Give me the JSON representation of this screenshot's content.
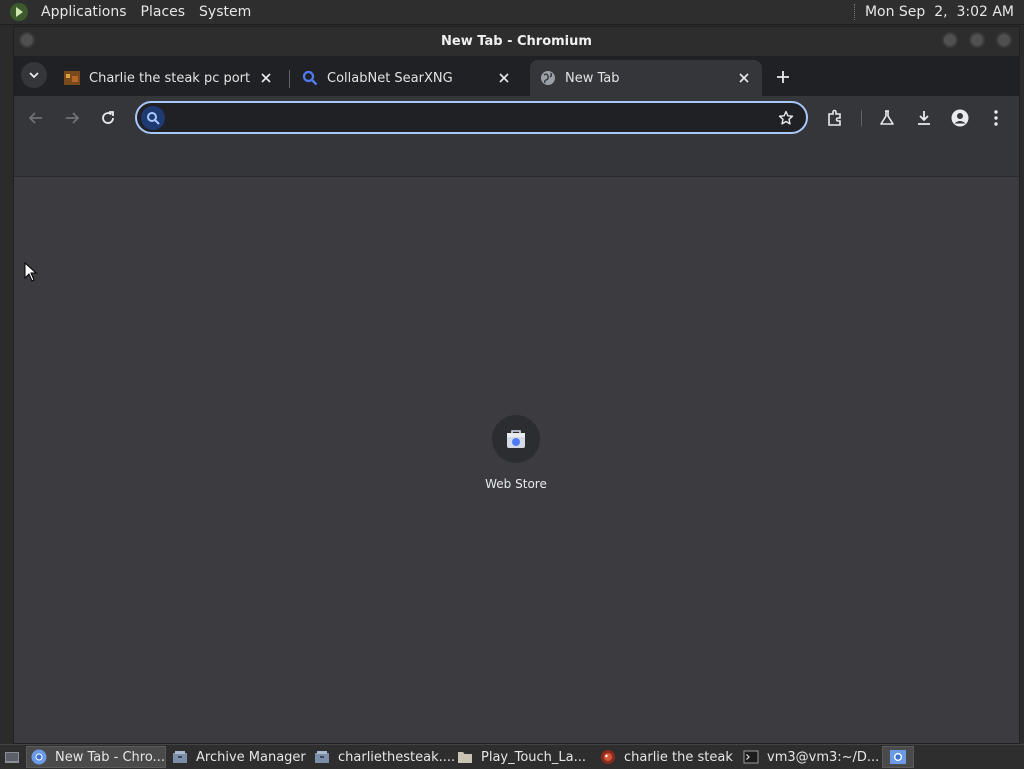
{
  "top_panel": {
    "menus": [
      "Applications",
      "Places",
      "System"
    ],
    "clock": "Mon Sep  2,  3:02 AM"
  },
  "window": {
    "title": "New Tab - Chromium"
  },
  "tabs": [
    {
      "label": "Charlie the steak pc port by L",
      "icon": "game-favicon",
      "active": false
    },
    {
      "label": "CollabNet SearXNG",
      "icon": "search-favicon",
      "active": false
    },
    {
      "label": "New Tab",
      "icon": "globe-favicon",
      "active": true
    }
  ],
  "omnibox": {
    "value": "",
    "placeholder": ""
  },
  "shortcuts": [
    {
      "label": "Web Store",
      "icon": "web-store-icon"
    }
  ],
  "taskbar": {
    "items": [
      {
        "label": "New Tab - Chro...",
        "icon": "chromium-icon",
        "active": true
      },
      {
        "label": "Archive Manager",
        "icon": "archive-icon",
        "active": false
      },
      {
        "label": "charliethesteak....",
        "icon": "archive-icon",
        "active": false
      },
      {
        "label": "Play_Touch_La...",
        "icon": "folder-icon",
        "active": false
      },
      {
        "label": "charlie the steak",
        "icon": "game-icon",
        "active": false
      },
      {
        "label": "vm3@vm3:~/D...",
        "icon": "terminal-icon",
        "active": false
      }
    ]
  },
  "colors": {
    "omnibox_focus_ring": "#a8c7fa",
    "tabstrip_bg": "#202124",
    "toolbar_bg": "#35363a",
    "content_bg": "#3b3b40"
  }
}
